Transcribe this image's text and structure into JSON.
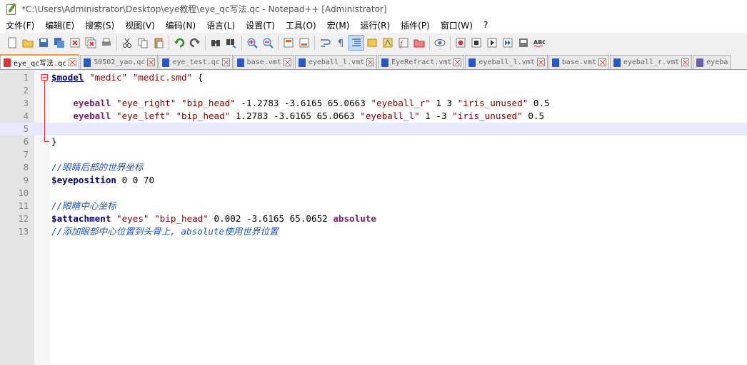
{
  "window": {
    "title": "*C:\\Users\\Administrator\\Desktop\\eye教程\\eye_qc写法.qc - Notepad++ [Administrator]"
  },
  "menu": [
    "文件(F)",
    "编辑(E)",
    "搜索(S)",
    "视图(V)",
    "编码(N)",
    "语言(L)",
    "设置(T)",
    "工具(O)",
    "宏(M)",
    "运行(R)",
    "插件(P)",
    "窗口(W)",
    "?"
  ],
  "toolbar": {
    "icons": [
      "new-file-icon",
      "open-file-icon",
      "save-icon",
      "save-all-icon",
      "close-icon",
      "close-all-icon",
      "print-icon",
      "cut-icon",
      "copy-icon",
      "paste-icon",
      "undo-icon",
      "redo-icon",
      "find-icon",
      "replace-icon",
      "zoom-in-icon",
      "zoom-out-icon",
      "sync-vertical-icon",
      "sync-horizontal-icon",
      "word-wrap-icon",
      "show-all-chars-icon",
      "indent-guide-icon",
      "udl-icon",
      "doc-map-icon",
      "function-list-icon",
      "folder-workspace-icon",
      "monitor-icon",
      "record-macro-icon",
      "stop-record-icon",
      "play-macro-icon",
      "play-multiple-icon",
      "save-macro-icon",
      "spellcheck-icon"
    ]
  },
  "tabs": [
    {
      "label": "eye_qc写法.qc",
      "active": true,
      "icon": "red"
    },
    {
      "label": "50502_yao.qc",
      "active": false,
      "icon": "blue"
    },
    {
      "label": "eye_test.qc",
      "active": false,
      "icon": "blue"
    },
    {
      "label": "base.vmt",
      "active": false,
      "icon": "blue"
    },
    {
      "label": "eyeball_l.vmt",
      "active": false,
      "icon": "blue"
    },
    {
      "label": "EyeRefract.vmt",
      "active": false,
      "icon": "blue"
    },
    {
      "label": "eyeball_l.vmt",
      "active": false,
      "icon": "blue"
    },
    {
      "label": "base.vmt",
      "active": false,
      "icon": "blue"
    },
    {
      "label": "eyeball_r.vmt",
      "active": false,
      "icon": "blue"
    },
    {
      "label": "eyeba",
      "active": false,
      "icon": "purple"
    }
  ],
  "editor": {
    "current_line": 5,
    "lines": [
      {
        "n": "1",
        "tokens": [
          {
            "t": "$model",
            "c": "kw kw-u"
          },
          {
            "t": " "
          },
          {
            "t": "\"medic\"",
            "c": "str"
          },
          {
            "t": " "
          },
          {
            "t": "\"medic.smd\"",
            "c": "str"
          },
          {
            "t": " {"
          }
        ]
      },
      {
        "n": "2",
        "tokens": []
      },
      {
        "n": "3",
        "tokens": [
          {
            "t": "    "
          },
          {
            "t": "eyeball",
            "c": "kw-purple"
          },
          {
            "t": " "
          },
          {
            "t": "\"eye_right\"",
            "c": "str"
          },
          {
            "t": " "
          },
          {
            "t": "\"bip_head\"",
            "c": "str"
          },
          {
            "t": " -1.2783 -3.6165 65.0663 "
          },
          {
            "t": "\"eyeball_r\"",
            "c": "str"
          },
          {
            "t": " 1 3 "
          },
          {
            "t": "\"iris_unused\"",
            "c": "str"
          },
          {
            "t": " 0.5"
          }
        ]
      },
      {
        "n": "4",
        "tokens": [
          {
            "t": "    "
          },
          {
            "t": "eyeball",
            "c": "kw-purple"
          },
          {
            "t": " "
          },
          {
            "t": "\"eye_left\"",
            "c": "str"
          },
          {
            "t": " "
          },
          {
            "t": "\"bip_head\"",
            "c": "str"
          },
          {
            "t": " 1.2783 -3.6165 65.0663 "
          },
          {
            "t": "\"eyeball_l\"",
            "c": "str"
          },
          {
            "t": " 1 -3 "
          },
          {
            "t": "\"iris_unused\"",
            "c": "str"
          },
          {
            "t": " 0.5"
          }
        ]
      },
      {
        "n": "5",
        "tokens": []
      },
      {
        "n": "6",
        "tokens": [
          {
            "t": "}"
          }
        ]
      },
      {
        "n": "7",
        "tokens": []
      },
      {
        "n": "8",
        "tokens": [
          {
            "t": "//眼睛后部的世界坐标",
            "c": "cmt"
          }
        ]
      },
      {
        "n": "9",
        "tokens": [
          {
            "t": "$eyeposition",
            "c": "kw"
          },
          {
            "t": " 0 0 70"
          }
        ]
      },
      {
        "n": "10",
        "tokens": []
      },
      {
        "n": "11",
        "tokens": [
          {
            "t": "//眼睛中心坐标",
            "c": "cmt"
          }
        ]
      },
      {
        "n": "12",
        "tokens": [
          {
            "t": "$attachment",
            "c": "kw"
          },
          {
            "t": " "
          },
          {
            "t": "\"eyes\"",
            "c": "str"
          },
          {
            "t": " "
          },
          {
            "t": "\"bip_head\"",
            "c": "str"
          },
          {
            "t": " 0.002 -3.6165 65.0652 "
          },
          {
            "t": "absolute",
            "c": "kw-purple"
          }
        ]
      },
      {
        "n": "13",
        "tokens": [
          {
            "t": "//添加眼部中心位置到头骨上, absolute使用世界位置",
            "c": "cmt"
          }
        ]
      }
    ]
  }
}
